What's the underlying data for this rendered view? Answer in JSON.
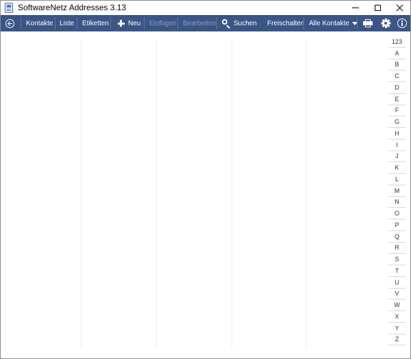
{
  "window": {
    "title": "SoftwareNetz Addresses 3.13"
  },
  "toolbar": {
    "kontakte_label": "Kontakte",
    "liste_label": "Liste",
    "etiketten_label": "Etiketten",
    "neu_label": "Neu",
    "einfuegen_label": "Einfügen",
    "bearbeiten_label": "Bearbeiten",
    "suchen_label": "Suchen",
    "freischalten_label": "Freischalten",
    "filter_label": "Alle Kontakte"
  },
  "alphabet_index": [
    "123",
    "A",
    "B",
    "C",
    "D",
    "E",
    "F",
    "G",
    "H",
    "I",
    "J",
    "K",
    "L",
    "M",
    "N",
    "O",
    "P",
    "Q",
    "R",
    "S",
    "T",
    "U",
    "V",
    "W",
    "X",
    "Y",
    "Z"
  ],
  "colors": {
    "toolbar_background": "#3b5586",
    "toolbar_text": "#ffffff",
    "toolbar_disabled_text": "#8c9cbf"
  }
}
